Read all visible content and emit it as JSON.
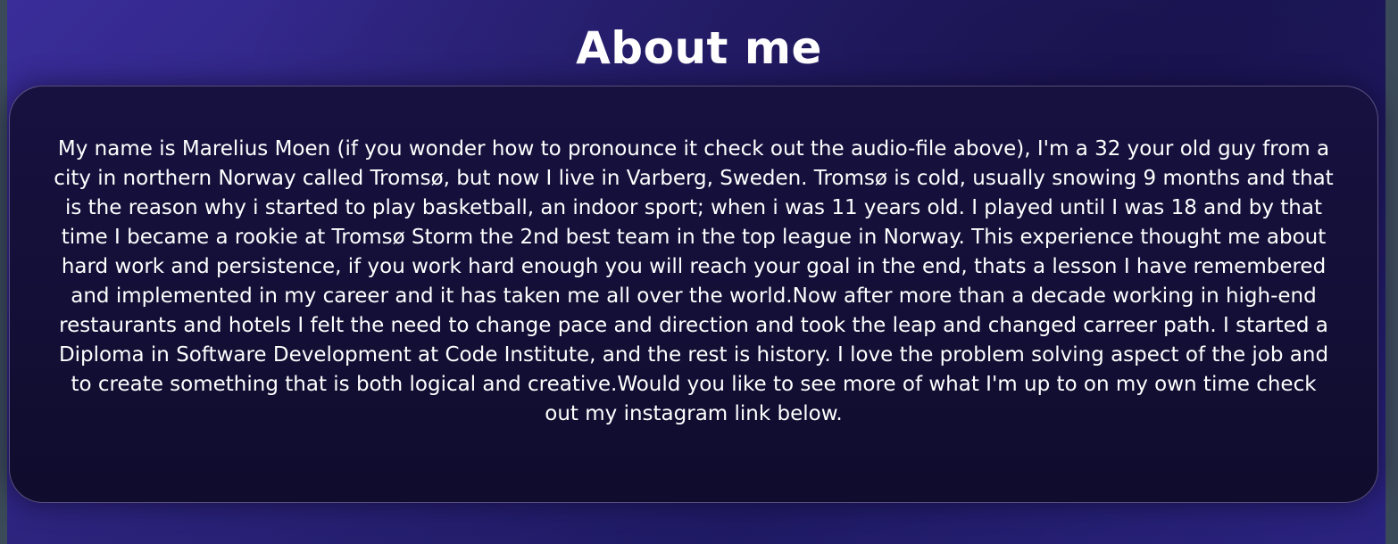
{
  "section": {
    "title": "About me",
    "paragraph": "My name is Marelius Moen (if you wonder how to pronounce it check out the audio-file above), I'm a 32 your old guy from a city in northern Norway called Tromsø, but now I live in Varberg, Sweden. Tromsø is cold, usually snowing 9 months and that is the reason why i started to play basketball, an indoor sport; when i was 11 years old. I played until I was 18 and by that time I became a rookie at Tromsø Storm the 2nd best team in the top league in Norway. This experience thought me about hard work and persistence, if you work hard enough you will reach your goal in the end, thats a lesson I have remembered and implemented in my career and it has taken me all over the world.Now after more than a decade working in high-end restaurants and hotels I felt the need to change pace and direction and took the leap and changed carreer path. I started a Diploma in Software Development at Code Institute, and the rest is history. I love the problem solving aspect of the job and to create something that is both logical and creative.Would you like to see more of what I'm up to on my own time check out my instagram link below."
  },
  "colors": {
    "background": "#2a2278",
    "card": "#130f37",
    "text": "#ffffff"
  }
}
